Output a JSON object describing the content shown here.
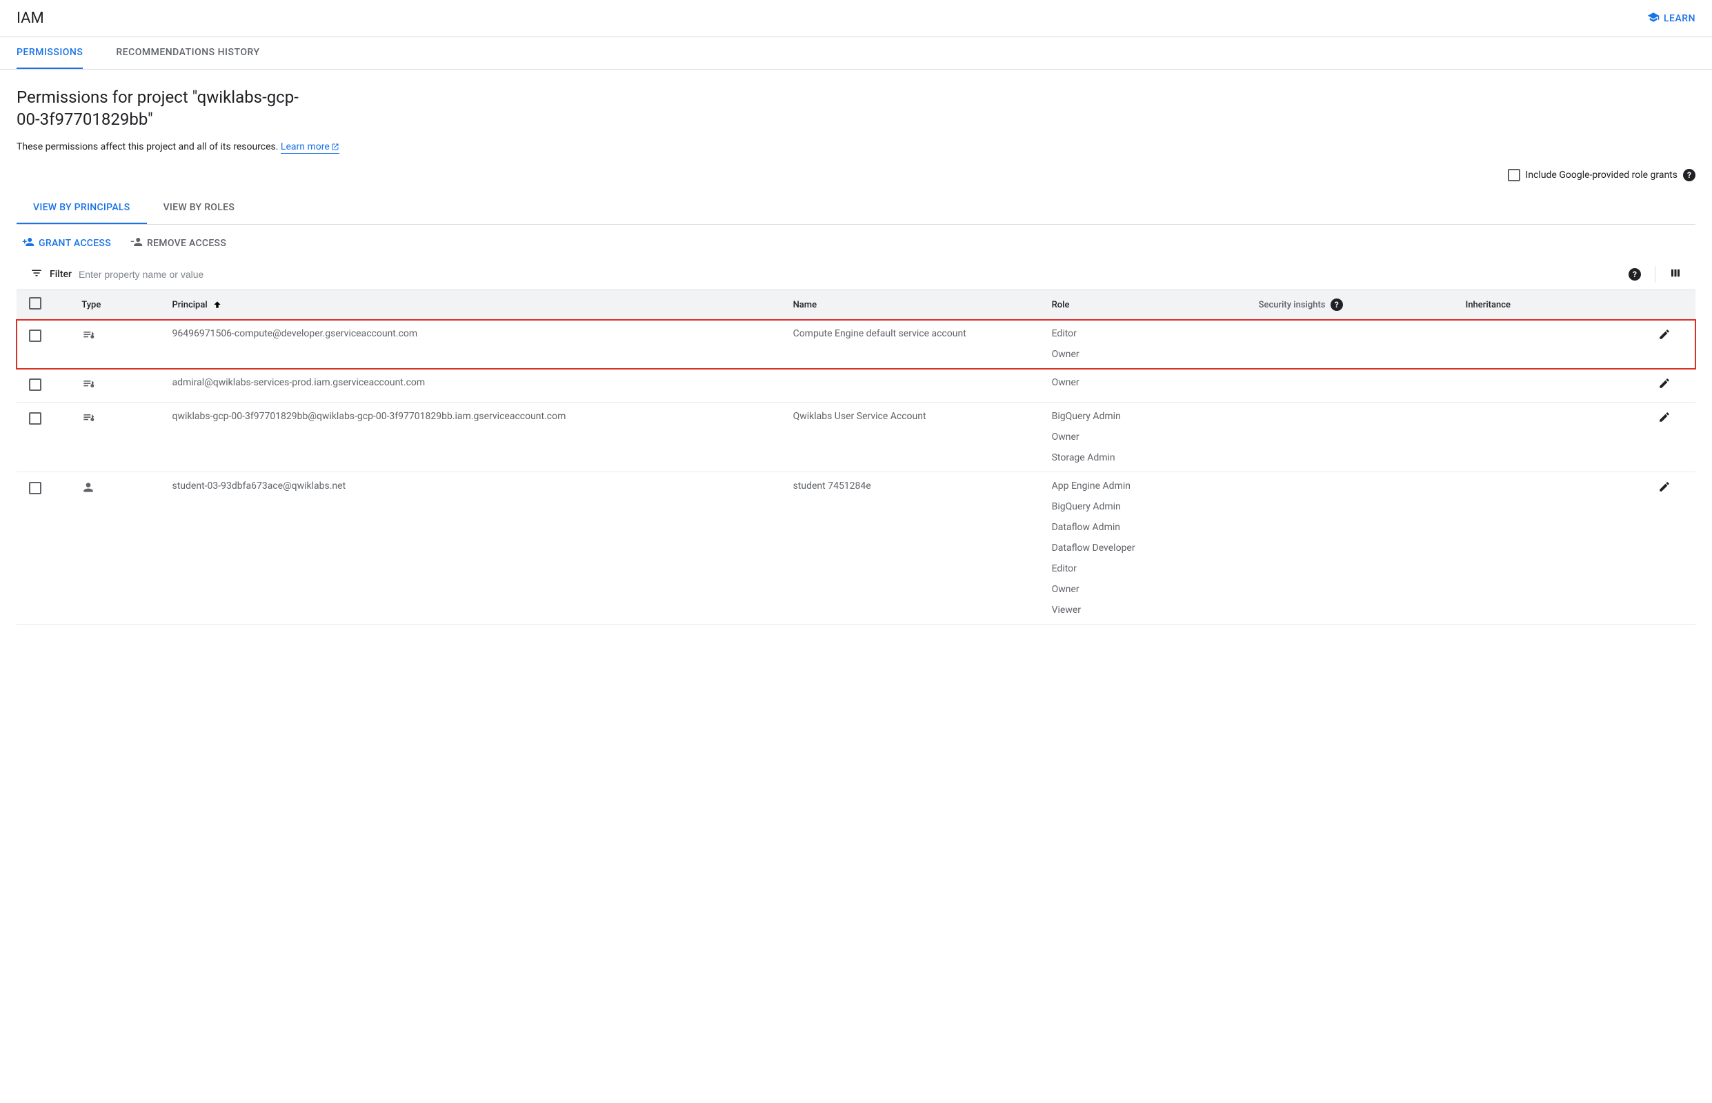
{
  "header": {
    "title": "IAM",
    "learn": "LEARN"
  },
  "topTabs": {
    "permissions": "PERMISSIONS",
    "recommendations": "RECOMMENDATIONS HISTORY"
  },
  "page": {
    "title": "Permissions for project \"qwiklabs-gcp-00-3f97701829bb\"",
    "subtitle": "These permissions affect this project and all of its resources. ",
    "learnMore": "Learn more"
  },
  "includeGoogle": "Include Google-provided role grants",
  "viewTabs": {
    "principals": "VIEW BY PRINCIPALS",
    "roles": "VIEW BY ROLES"
  },
  "actions": {
    "grant": "GRANT ACCESS",
    "remove": "REMOVE ACCESS"
  },
  "filter": {
    "label": "Filter",
    "placeholder": "Enter property name or value"
  },
  "columns": {
    "type": "Type",
    "principal": "Principal",
    "name": "Name",
    "role": "Role",
    "insights": "Security insights",
    "inheritance": "Inheritance"
  },
  "rows": [
    {
      "type": "service-account",
      "principal": "96496971506-compute@developer.gserviceaccount.com",
      "name": "Compute Engine default service account",
      "roles": [
        "Editor",
        "Owner"
      ],
      "highlight": true
    },
    {
      "type": "service-account",
      "principal": "admiral@qwiklabs-services-prod.iam.gserviceaccount.com",
      "name": "",
      "roles": [
        "Owner"
      ]
    },
    {
      "type": "service-account",
      "principal": "qwiklabs-gcp-00-3f97701829bb@qwiklabs-gcp-00-3f97701829bb.iam.gserviceaccount.com",
      "name": "Qwiklabs User Service Account",
      "roles": [
        "BigQuery Admin",
        "Owner",
        "Storage Admin"
      ]
    },
    {
      "type": "user",
      "principal": "student-03-93dbfa673ace@qwiklabs.net",
      "name": "student 7451284e",
      "roles": [
        "App Engine Admin",
        "BigQuery Admin",
        "Dataflow Admin",
        "Dataflow Developer",
        "Editor",
        "Owner",
        "Viewer"
      ]
    }
  ]
}
